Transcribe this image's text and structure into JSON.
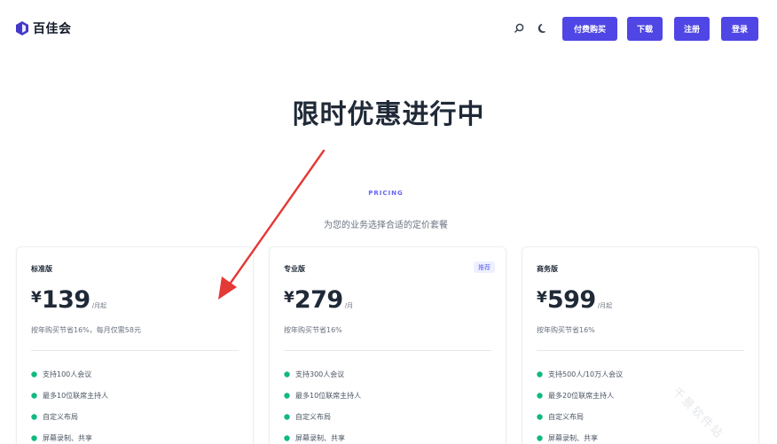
{
  "header": {
    "logo_text": "百佳会",
    "icons": [
      "search-icon",
      "theme-toggle-icon"
    ],
    "buttons": {
      "buy": "付费购买",
      "download": "下载",
      "register": "注册",
      "login": "登录"
    }
  },
  "hero": {
    "title": "限时优惠进行中"
  },
  "pricing": {
    "label": "PRICING",
    "subtitle": "为您的业务选择合适的定价套餐",
    "plans": [
      {
        "name": "标准版",
        "badge": "",
        "currency": "¥",
        "price": "139",
        "unit": "/月起",
        "note": "按年购买节省16%，每月仅需58元",
        "features": [
          "支持100人会议",
          "最多10位联席主持人",
          "自定义布局",
          "屏幕录制、共享"
        ]
      },
      {
        "name": "专业版",
        "badge": "推荐",
        "currency": "¥",
        "price": "279",
        "unit": "/月",
        "note": "按年购买节省16%",
        "features": [
          "支持300人会议",
          "最多10位联席主持人",
          "自定义布局",
          "屏幕录制、共享"
        ]
      },
      {
        "name": "商务版",
        "badge": "",
        "currency": "¥",
        "price": "599",
        "unit": "/月起",
        "note": "按年购买节省16%",
        "features": [
          "支持500人/10万人会议",
          "最多20位联席主持人",
          "自定义布局",
          "屏幕录制、共享"
        ]
      }
    ]
  },
  "annotation": {
    "arrow_color": "#e53935"
  },
  "watermark": "千景软件站",
  "colors": {
    "accent": "#4f46e5",
    "check": "#10b981"
  }
}
